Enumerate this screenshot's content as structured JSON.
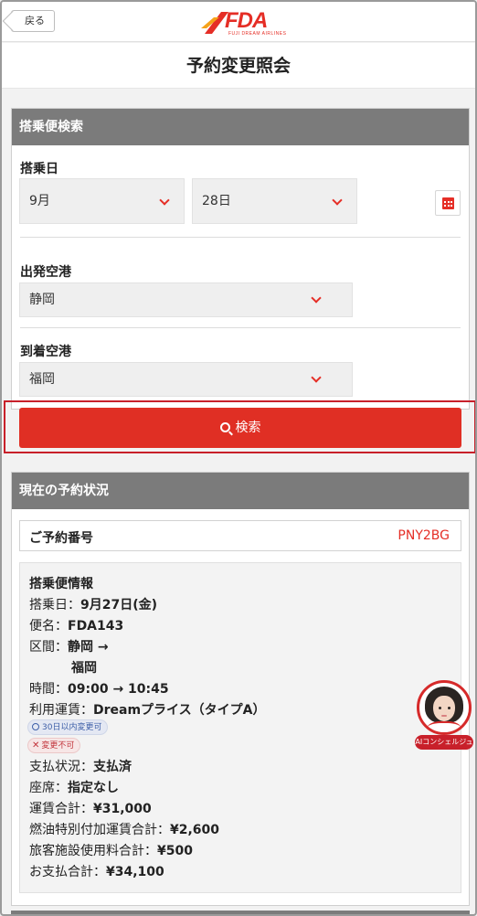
{
  "header": {
    "back_label": "戻る",
    "logo_text": "FDA",
    "logo_sub": "FUJI DREAM AIRLINES",
    "page_title": "予約変更照会"
  },
  "search": {
    "section_title": "搭乗便検索",
    "date_label": "搭乗日",
    "month_value": "9月",
    "day_value": "28日",
    "departure_label": "出発空港",
    "departure_value": "静岡",
    "arrival_label": "到着空港",
    "arrival_value": "福岡",
    "search_button": "検索"
  },
  "reservation": {
    "section_title": "現在の予約状況",
    "number_label": "ご予約番号",
    "number_value": "PNY2BG",
    "info_title": "搭乗便情報",
    "date_key": "搭乗日：",
    "date_val": "9月27日(金)",
    "flight_key": "便名：",
    "flight_val": "FDA143",
    "route_key": "区間：",
    "route_from": "静岡 →",
    "route_to": "福岡",
    "time_key": "時間：",
    "time_val": "09:00 → 10:45",
    "fare_key": "利用運賃：",
    "fare_val": "Dreamプライス（タイプA）",
    "tag_change_ok": "30日以内変更可",
    "tag_change_ng": "変更不可",
    "payment_key": "支払状況：",
    "payment_val": "支払済",
    "seat_key": "座席：",
    "seat_val": "指定なし",
    "fare_total_key": "運賃合計：",
    "fare_total_val": "¥31,000",
    "fuel_key": "燃油特別付加運賃合計：",
    "fuel_val": "¥2,600",
    "facility_key": "旅客施設使用料合計：",
    "facility_val": "¥500",
    "pay_total_key": "お支払合計：",
    "pay_total_val": "¥34,100"
  },
  "ai": {
    "label": "AIコンシェルジュ"
  },
  "colors": {
    "accent": "#e02f24",
    "section_header": "#7b7b7b",
    "highlight_border": "#c8202a"
  }
}
